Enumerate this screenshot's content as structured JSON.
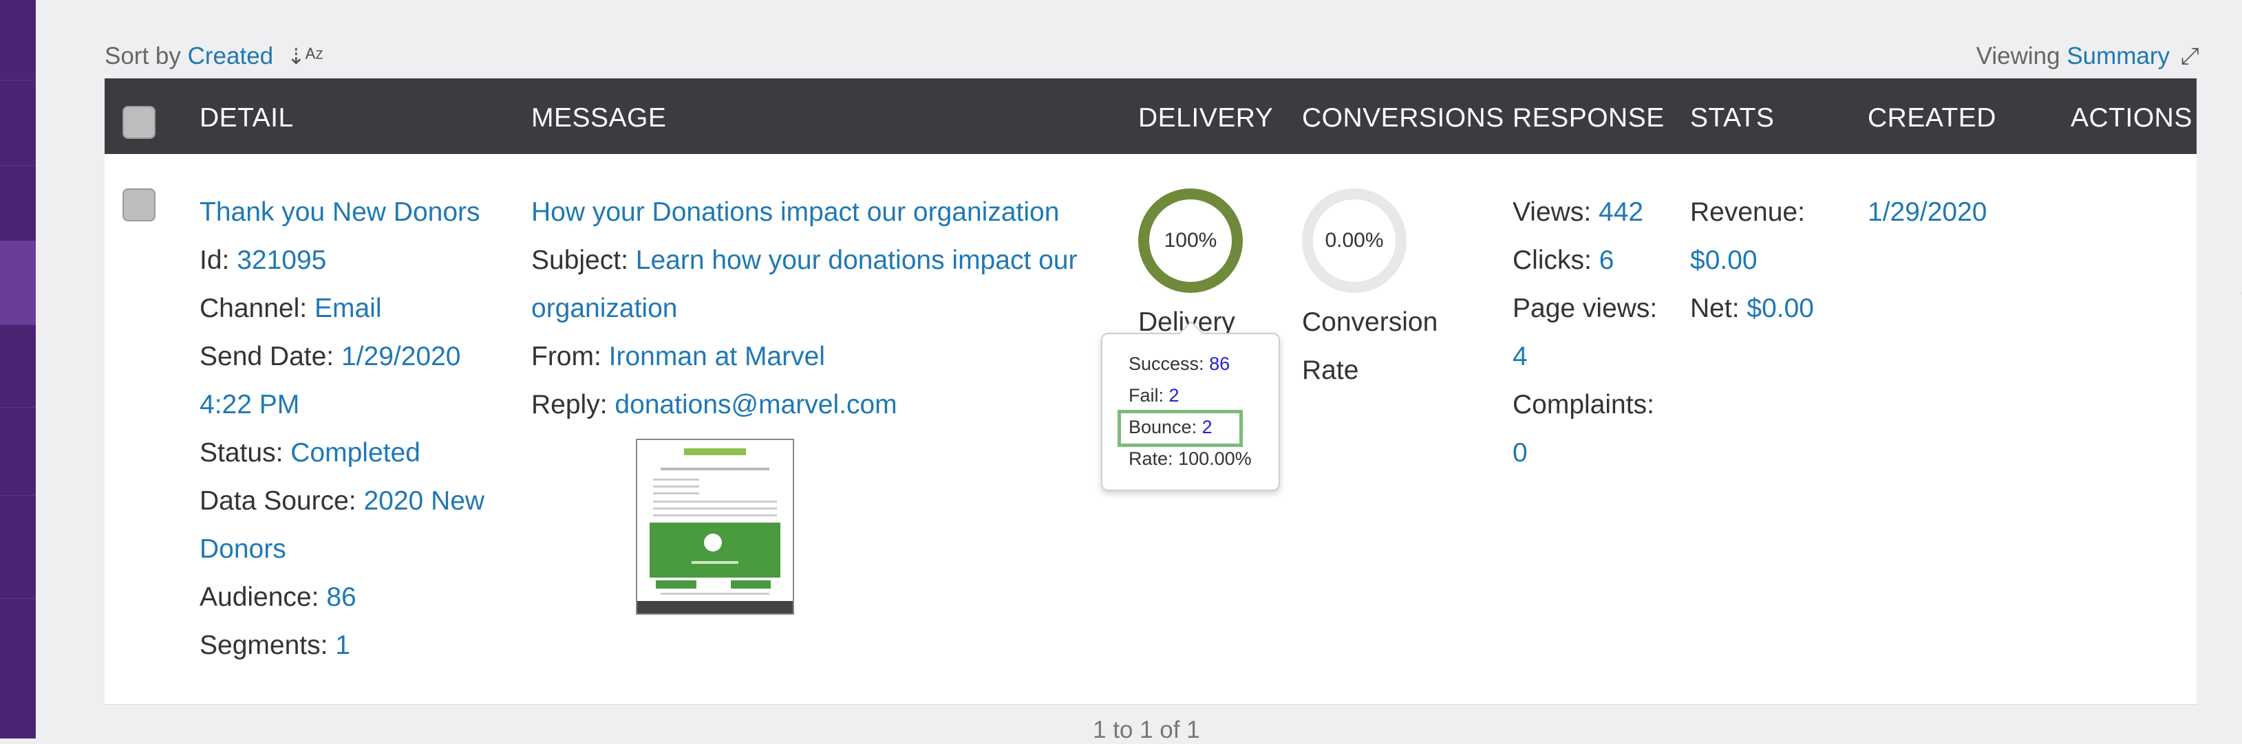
{
  "toolbar": {
    "sort_prefix": "Sort by",
    "sort_field": "Created",
    "sort_icon": "sort-desc-icon",
    "viewing_prefix": "Viewing",
    "viewing_mode": "Summary",
    "expand_icon": "expand-icon"
  },
  "columns": [
    "DETAIL",
    "MESSAGE",
    "DELIVERY",
    "CONVERSIONS",
    "RESPONSE",
    "STATS",
    "CREATED",
    "ACTIONS"
  ],
  "row": {
    "detail": {
      "name": "Thank you New Donors",
      "id_label": "Id:",
      "id_value": "321095",
      "channel_label": "Channel:",
      "channel_value": "Email",
      "send_date_label": "Send Date:",
      "send_date_value_line1": "1/29/2020",
      "send_date_value_line2": "4:22 PM",
      "status_label": "Status:",
      "status_value": "Completed",
      "data_source_label": "Data Source:",
      "data_source_value_line1": "2020 New",
      "data_source_value_line2": "Donors",
      "audience_label": "Audience:",
      "audience_value": "86",
      "segments_label": "Segments:",
      "segments_value": "1"
    },
    "message": {
      "title": "How your Donations impact our organization",
      "subject_label": "Subject:",
      "subject_value_line1": "Learn how your donations impact our",
      "subject_value_line2": "organization",
      "from_label": "From:",
      "from_value": "Ironman at Marvel",
      "reply_label": "Reply:",
      "reply_value": "donations@marvel.com"
    },
    "delivery": {
      "percent_text": "100%",
      "caption": "Delivery",
      "percent": 100,
      "ring_color": "#6f8a3a"
    },
    "conversions": {
      "percent_text": "0.00%",
      "caption_line1": "Conversion",
      "caption_line2": "Rate",
      "percent": 0,
      "ring_color": "#e5e5e5"
    },
    "response": {
      "views_label": "Views:",
      "views_value": "442",
      "clicks_label": "Clicks:",
      "clicks_value": "6",
      "page_views_label": "Page views:",
      "page_views_value": "4",
      "complaints_label": "Complaints:",
      "complaints_value": "0"
    },
    "stats": {
      "revenue_label": "Revenue:",
      "revenue_value": "$0.00",
      "net_label": "Net:",
      "net_value": "$0.00"
    },
    "created": "1/29/2020",
    "actions_icon": "more-horizontal-icon"
  },
  "tooltip": {
    "success_label": "Success:",
    "success_value": "86",
    "fail_label": "Fail:",
    "fail_value": "2",
    "bounce_label": "Bounce:",
    "bounce_value": "2",
    "rate_label": "Rate:",
    "rate_value": "100.00%"
  },
  "pager": {
    "text": "1 to 1 of 1"
  },
  "colors": {
    "header_bg": "#3b3b40",
    "link": "#1f78b4",
    "nav_bg": "#4b2473",
    "highlight_box": "#7dbb7d"
  }
}
